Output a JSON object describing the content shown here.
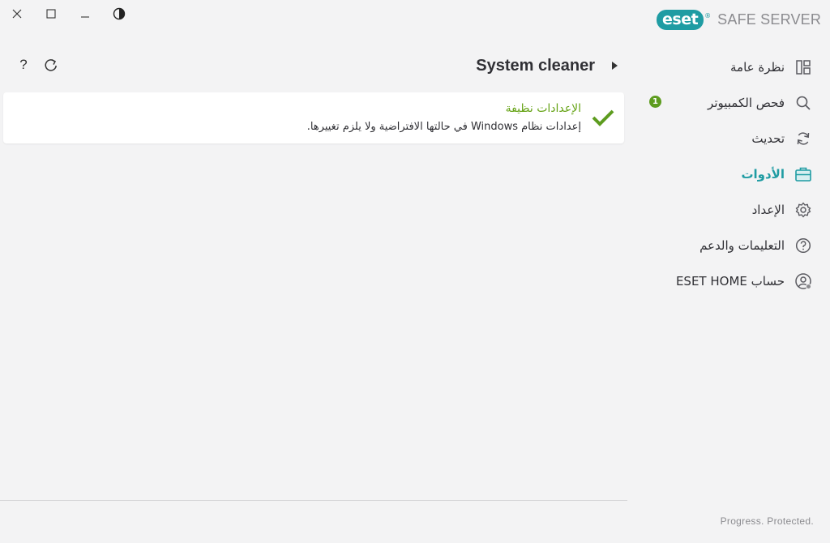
{
  "window": {
    "close_icon": "close-icon",
    "maximize_icon": "maximize-icon",
    "minimize_icon": "minimize-icon",
    "theme_icon": "contrast-icon"
  },
  "brand": {
    "logo_text": "eset",
    "product_name": "SAFE SERVER",
    "accent_color": "#1f9ca3"
  },
  "header": {
    "title": "System cleaner",
    "help_symbol": "?",
    "refresh_icon": "refresh-icon"
  },
  "status_card": {
    "title": "الإعدادات نظيفة",
    "description": "إعدادات نظام Windows في حالتها الافتراضية ولا يلزم تغييرها.",
    "title_color": "#66a316"
  },
  "sidebar": {
    "items": [
      {
        "label": "نظرة عامة",
        "icon": "overview-icon"
      },
      {
        "label": "فحص الكمبيوتر",
        "icon": "search-icon",
        "badge": "1"
      },
      {
        "label": "تحديث",
        "icon": "update-icon"
      },
      {
        "label": "الأدوات",
        "icon": "toolbox-icon",
        "active": true
      },
      {
        "label": "الإعداد",
        "icon": "gear-icon"
      },
      {
        "label": "التعليمات والدعم",
        "icon": "help-icon"
      },
      {
        "label": "حساب ESET HOME",
        "icon": "account-icon"
      }
    ]
  },
  "footer": {
    "tagline": "Progress. Protected."
  }
}
